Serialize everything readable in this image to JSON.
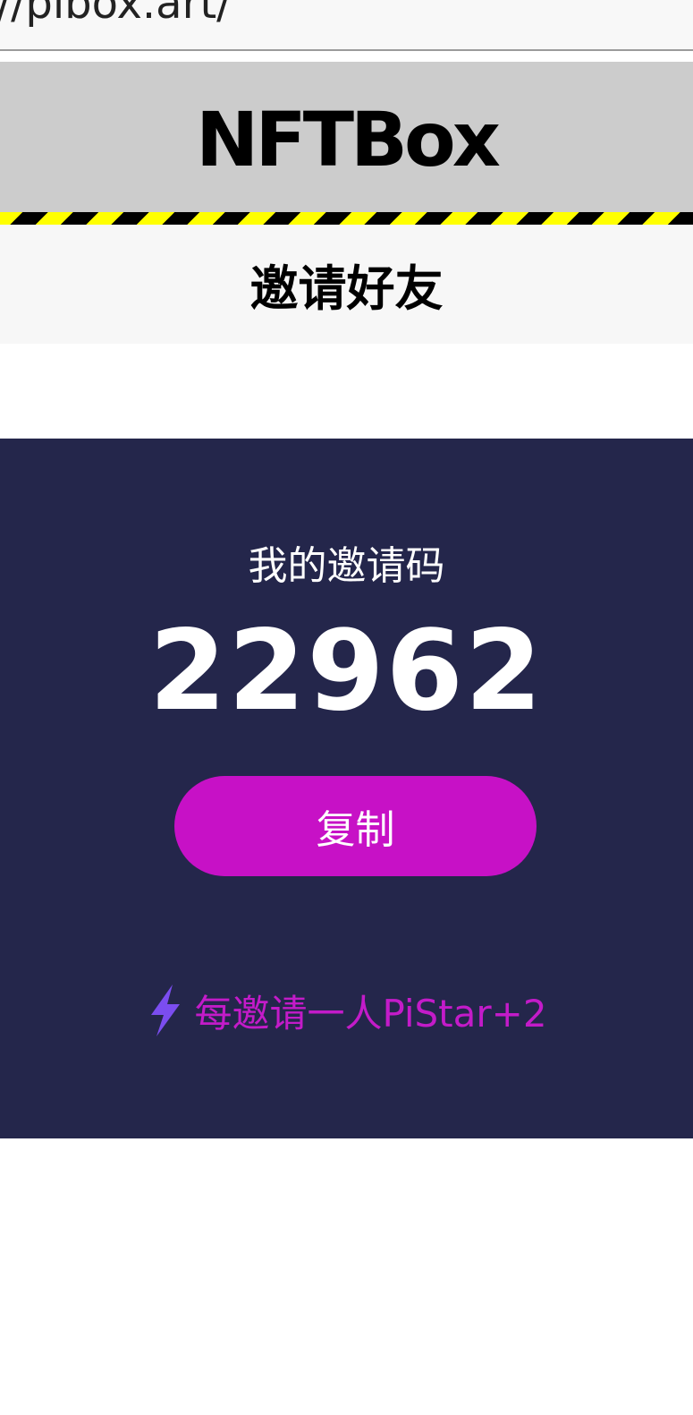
{
  "browser": {
    "url": "//pibox.art/"
  },
  "header": {
    "brand": "NFTBox",
    "page_title": "邀请好友"
  },
  "invite": {
    "label": "我的邀请码",
    "code": "22962",
    "copy_label": "复制",
    "reward_text": "每邀请一人PiStar+2",
    "reward_icon": "lightning-bolt-icon"
  },
  "colors": {
    "panel_bg": "#24264b",
    "button_bg": "#c711c6",
    "reward_text": "#c31bc9",
    "bolt": "#7b4df0",
    "brand_bar_bg": "#cccccc",
    "stripe_yellow": "#ffff00"
  }
}
